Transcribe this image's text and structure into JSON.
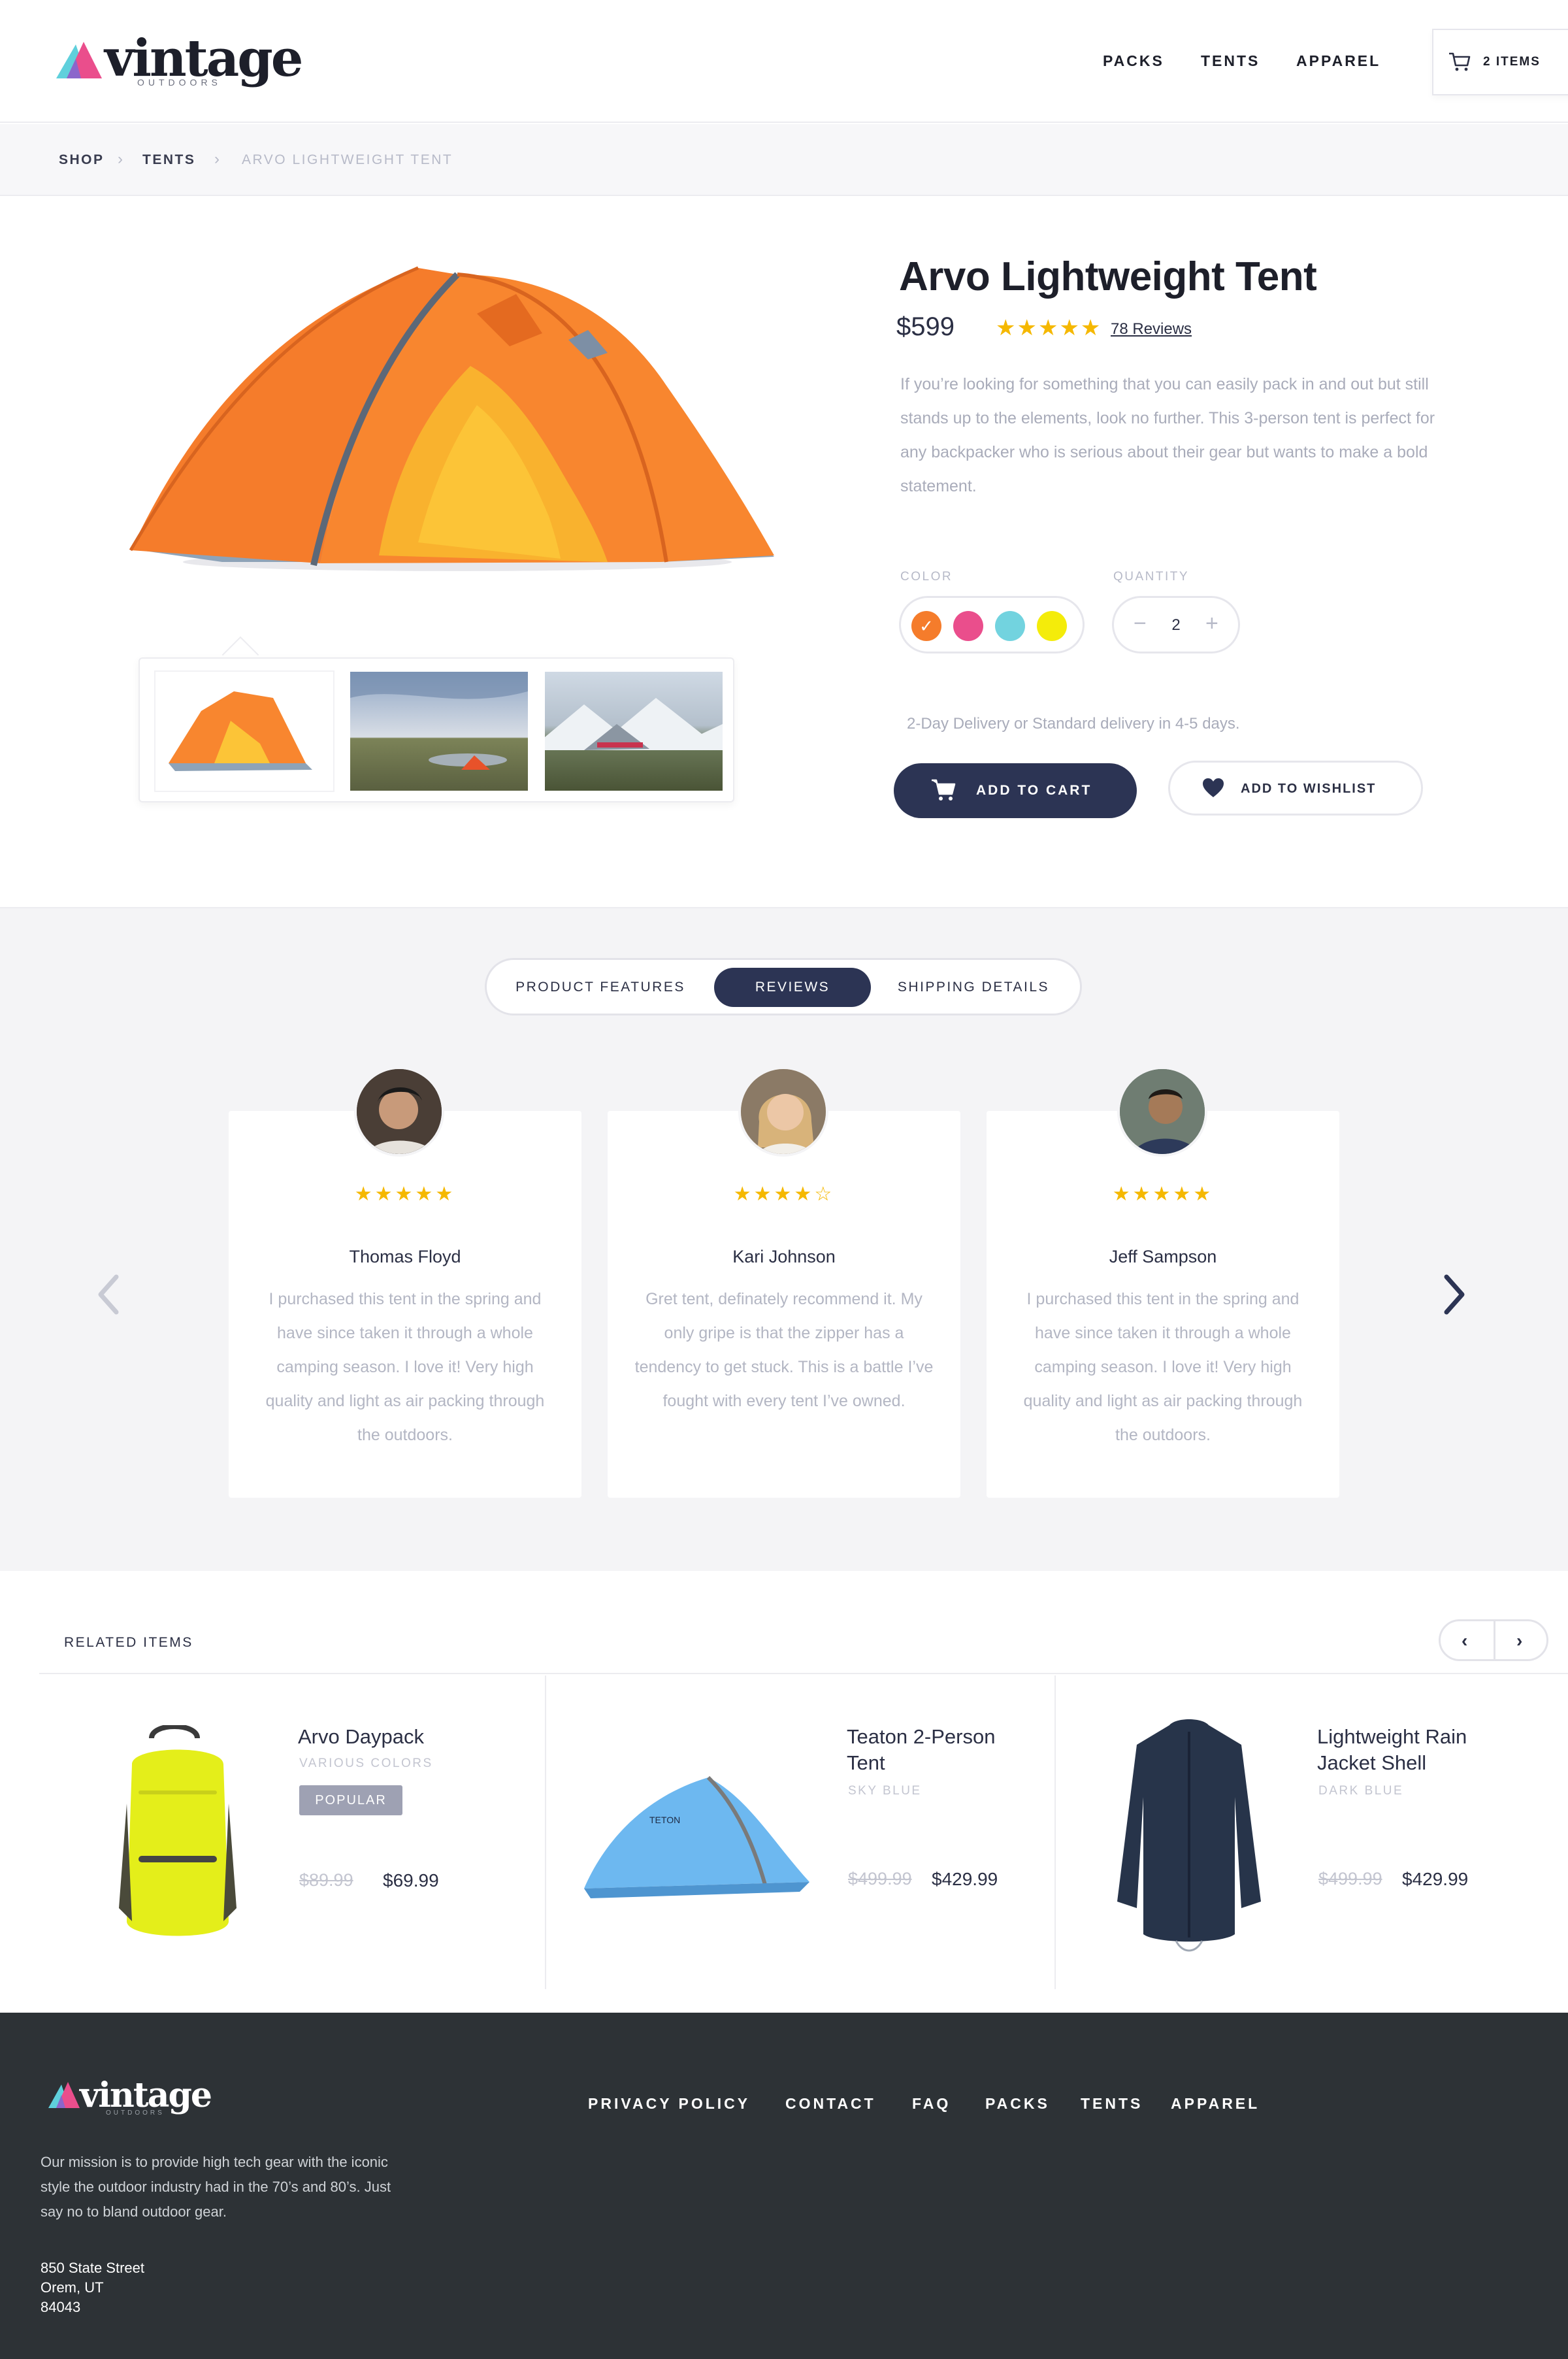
{
  "header": {
    "logo_word": "vintage",
    "logo_sub": "OUTDOORS",
    "nav": [
      "PACKS",
      "TENTS",
      "APPAREL"
    ],
    "cart_label": "2 ITEMS"
  },
  "breadcrumb": [
    "SHOP",
    "TENTS",
    "ARVO LIGHTWEIGHT TENT"
  ],
  "product": {
    "title": "Arvo Lightweight Tent",
    "price": "$599",
    "stars": "★★★★★",
    "reviews_link": "78 Reviews",
    "description": "If you’re looking for something that you can easily pack in and out but still stands up to the elements, look no further. This 3-person tent is perfect for any backpacker who is serious about their gear but wants to make a bold statement.",
    "color_label": "COLOR",
    "colors": [
      "#f57c2b",
      "#ea4e8c",
      "#72d3df",
      "#f4ec0a"
    ],
    "quantity_label": "QUANTITY",
    "quantity": "2",
    "qty_minus": "−",
    "qty_plus": "+",
    "delivery": "2-Day Delivery or Standard delivery in 4-5 days.",
    "add_to_cart": "ADD TO CART",
    "add_to_wishlist": "ADD TO WISHLIST"
  },
  "tabs": [
    "PRODUCT FEATURES",
    "REVIEWS",
    "SHIPPING DETAILS"
  ],
  "reviews": [
    {
      "stars": "★★★★★",
      "name": "Thomas Floyd",
      "text": "I purchased this tent in the spring and have since taken it through a whole camping season. I love it! Very high quality and light as air packing through the outdoors."
    },
    {
      "stars": "★★★★☆",
      "name": "Kari Johnson",
      "text": "Gret tent, definately recommend it. My only gripe is that the zipper has a tendency to get stuck. This is a battle I’ve fought with every tent I’ve owned."
    },
    {
      "stars": "★★★★★",
      "name": "Jeff Sampson",
      "text": "I purchased this tent in the spring and have since taken it through a whole camping season. I love it! Very high quality and light as air packing through the outdoors."
    }
  ],
  "related": {
    "label": "RELATED ITEMS",
    "items": [
      {
        "name": "Arvo Daypack",
        "sub": "VARIOUS COLORS",
        "badge": "POPULAR",
        "old_price": "$89.99",
        "price": "$69.99"
      },
      {
        "name_line1": "Teaton 2-Person",
        "name_line2": "Tent",
        "sub": "SKY BLUE",
        "old_price": "$499.99",
        "price": "$429.99"
      },
      {
        "name_line1": "Lightweight Rain",
        "name_line2": "Jacket Shell",
        "sub": "DARK BLUE",
        "old_price": "$499.99",
        "price": "$429.99"
      }
    ]
  },
  "footer": {
    "logo_word": "vintage",
    "logo_sub": "OUTDOORS",
    "mission": "Our  mission is to provide high tech gear with the iconic style the outdoor industry had in the 70’s and 80’s. Just say no to bland outdoor gear.",
    "address": [
      "850 State Street",
      "Orem, UT",
      "84043"
    ],
    "links": [
      "PRIVACY POLICY",
      "CONTACT",
      "FAQ",
      "PACKS",
      "TENTS",
      "APPAREL"
    ]
  }
}
